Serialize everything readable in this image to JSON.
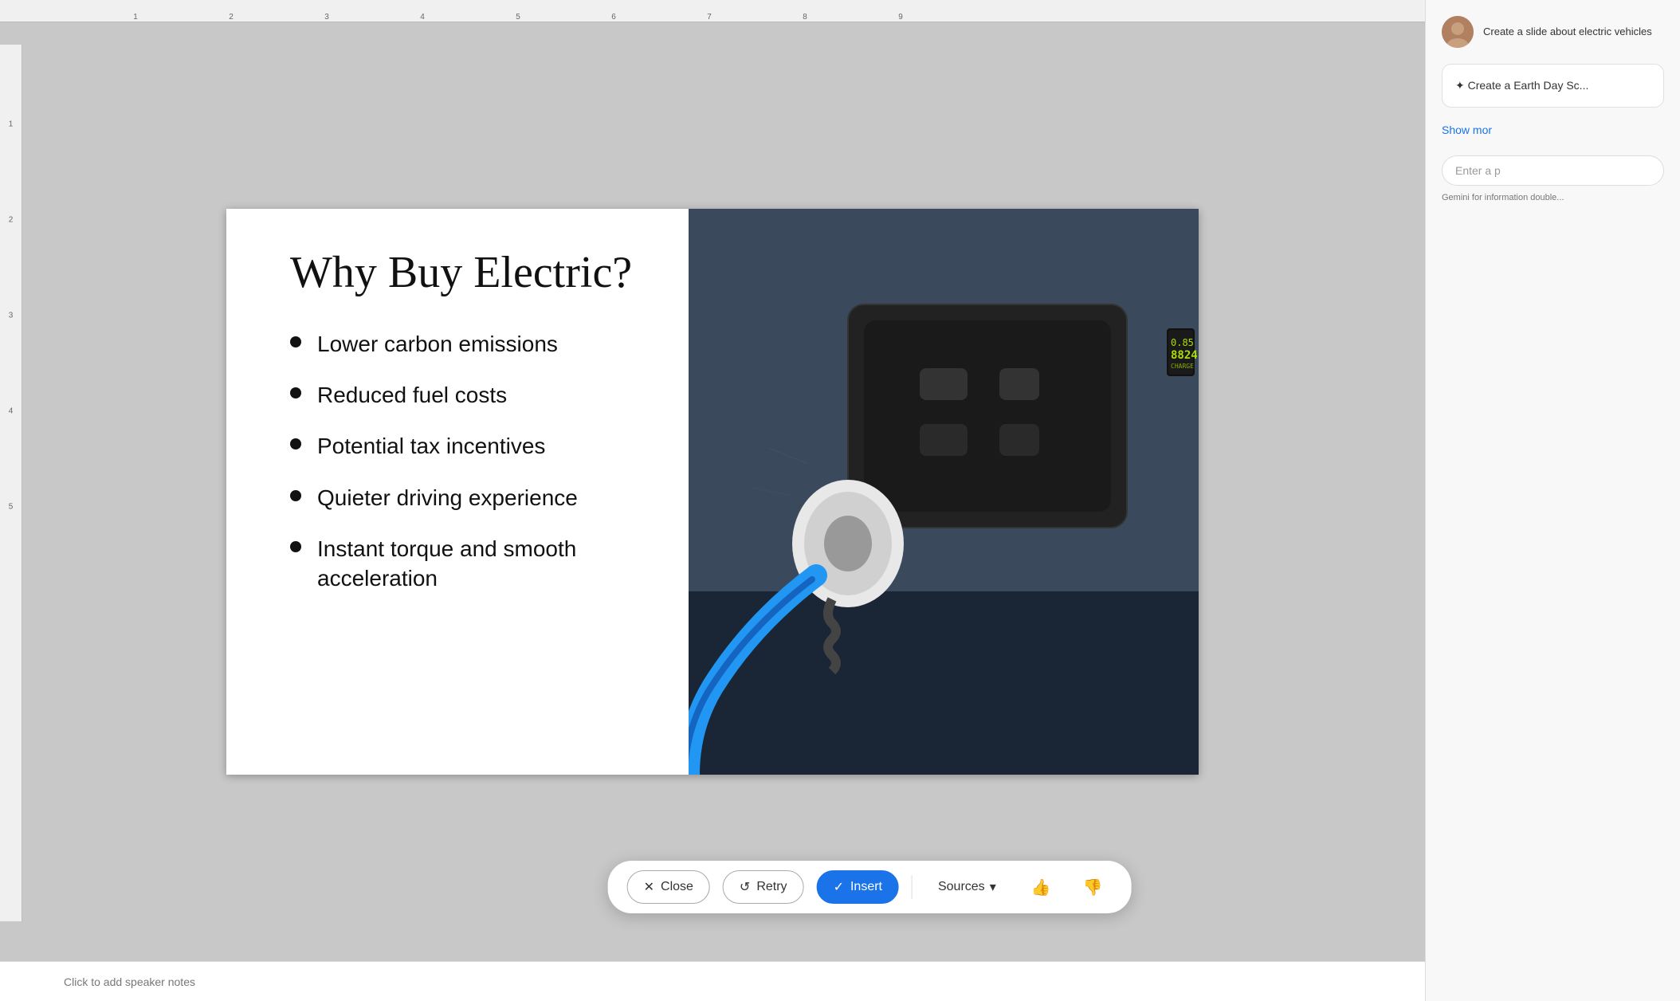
{
  "slide": {
    "title": "Why Buy Electric?",
    "bullets": [
      "Lower carbon emissions",
      "Reduced fuel costs",
      "Potential tax incentives",
      "Quieter driving experience",
      "Instant torque and smooth acceleration"
    ]
  },
  "action_bar": {
    "close_label": "Close",
    "retry_label": "Retry",
    "insert_label": "Insert",
    "sources_label": "Sources"
  },
  "notes": {
    "placeholder": "Click to add speaker notes"
  },
  "sidebar": {
    "prompt_text": "Create a slide about electric vehicles",
    "suggestion_label": "✦ Create a Earth Day Sc...",
    "show_more_label": "Show mor",
    "input_placeholder": "Enter a p",
    "footer_text": "Gemini for information double..."
  },
  "ruler": {
    "marks": [
      "1",
      "2",
      "3",
      "4",
      "5",
      "6",
      "7",
      "8",
      "9"
    ]
  },
  "colors": {
    "accent_blue": "#1a73e8",
    "bullet_color": "#111111",
    "slide_bg": "#ffffff"
  }
}
